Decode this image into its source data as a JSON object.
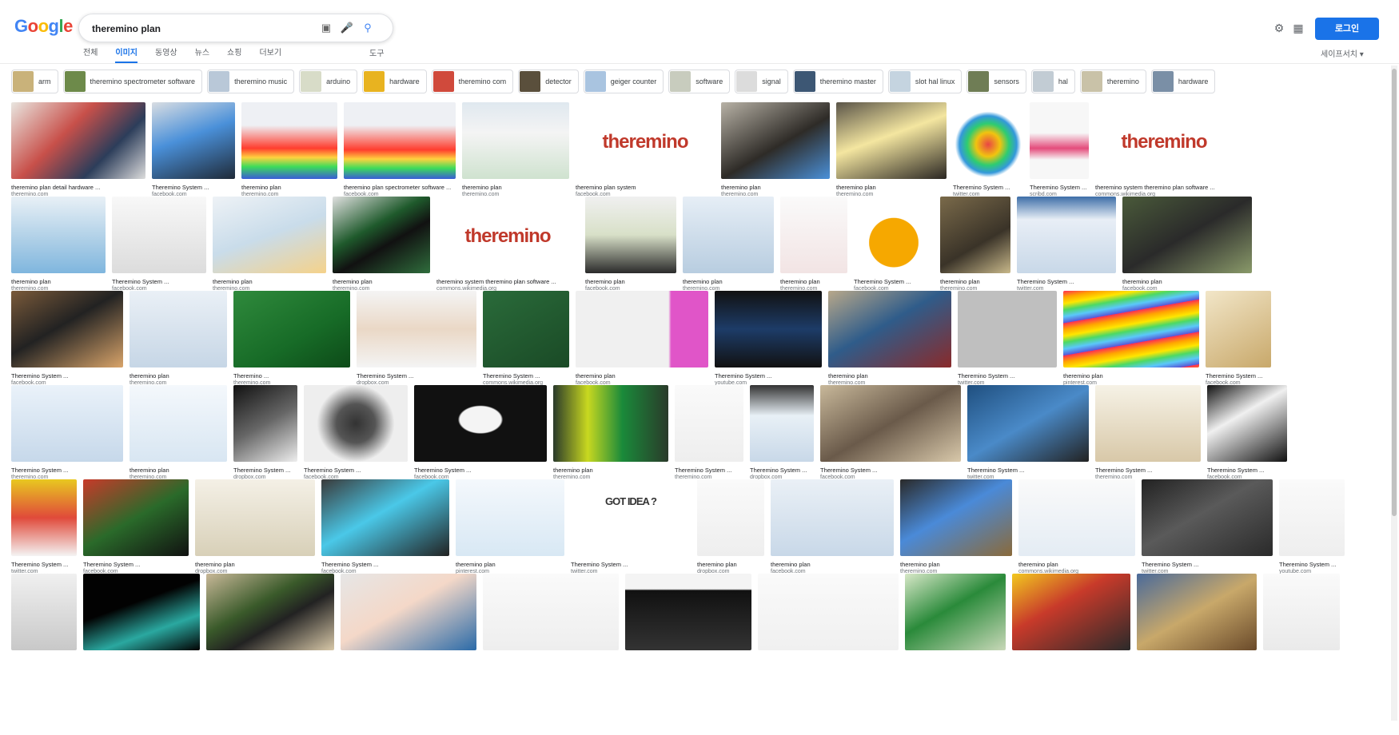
{
  "logo": "Google",
  "search": {
    "query": "theremino plan"
  },
  "header": {
    "sign_in": "로그인"
  },
  "tabs": [
    {
      "label": "전체",
      "active": false
    },
    {
      "label": "이미지",
      "active": true
    },
    {
      "label": "동영상",
      "active": false
    },
    {
      "label": "뉴스",
      "active": false
    },
    {
      "label": "쇼핑",
      "active": false
    },
    {
      "label": "더보기",
      "active": false
    }
  ],
  "tools": "도구",
  "safesearch": "세이프서치 ▾",
  "chips": [
    {
      "label": "arm",
      "color": "#c9b27a"
    },
    {
      "label": "theremino spectrometer software",
      "color": "#6d8a4a"
    },
    {
      "label": "theremino music",
      "color": "#b9c8d8"
    },
    {
      "label": "arduino",
      "color": "#d8dcc8"
    },
    {
      "label": "hardware",
      "color": "#e8b320"
    },
    {
      "label": "theremino com",
      "color": "#d04a3c"
    },
    {
      "label": "detector",
      "color": "#5a4f3c"
    },
    {
      "label": "geiger counter",
      "color": "#a9c4e0"
    },
    {
      "label": "software",
      "color": "#c8ccbe"
    },
    {
      "label": "signal",
      "color": "#dcdcdc"
    },
    {
      "label": "theremino master",
      "color": "#3d5774"
    },
    {
      "label": "slot hal linux",
      "color": "#c5d4e0"
    },
    {
      "label": "sensors",
      "color": "#6f7d55"
    },
    {
      "label": "hal",
      "color": "#c2ccd4"
    },
    {
      "label": "theremino",
      "color": "#c9c2a8"
    },
    {
      "label": "hardware",
      "color": "#7a8fa6"
    }
  ],
  "results": [
    [
      {
        "caption": "theremino plan detail hardware ...",
        "source": "theremino.com",
        "w": 168,
        "bg": "linear-gradient(135deg,#e9e6e0,#c8504a 40%,#2c3d5a 70%,#ddd)"
      },
      {
        "caption": "Theremino System ...",
        "source": "facebook.com",
        "w": 104,
        "bg": "linear-gradient(160deg,#d9dde2,#4a90d9 45%,#1f2a38)"
      },
      {
        "caption": "theremino plan",
        "source": "theremino.com",
        "w": 120,
        "bg": "linear-gradient(180deg,#eef0f4 30%,#ff3d2e 60%,#ffd23f 72%,#3ddc5a 84%,#3a5bd8)"
      },
      {
        "caption": "theremino plan spectrometer software ...",
        "source": "facebook.com",
        "w": 140,
        "bg": "linear-gradient(180deg,#eef0f4 30%,#ff3d2e 62%,#ffd23f 74%,#3ddc5a 86%,#3a5bd8)"
      },
      {
        "caption": "theremino plan",
        "source": "theremino.com",
        "w": 134,
        "bg": "linear-gradient(180deg,#dfe8ef,#f4f4f4 40%,#cfe2cf)"
      },
      {
        "caption": "theremino plan system",
        "source": "facebook.com",
        "w": 174,
        "bg": "#ffffff",
        "brand": "theremino"
      },
      {
        "caption": "theremino plan",
        "source": "theremino.com",
        "w": 136,
        "bg": "linear-gradient(150deg,#b8b2a6,#2e2b27 55%,#4a90d9)"
      },
      {
        "caption": "theremino plan",
        "source": "theremino.com",
        "w": 138,
        "bg": "linear-gradient(160deg,#5a5448,#f4e6a0 45%,#2a2622)"
      },
      {
        "caption": "Theremino System ...",
        "source": "twitter.com",
        "w": 88,
        "bg": "radial-gradient(circle at 50% 55%,#e94545 0,#f1c40f 22%,#2ecc71 38%,#3498db 52%,#fff 60%)"
      },
      {
        "caption": "Theremino System ...",
        "source": "scribd.com",
        "w": 74,
        "bg": "linear-gradient(180deg,#f7f7f7 40%,#e44c7b 60%,#f7f7f7 75%)"
      },
      {
        "caption": "theremino system theremino plan software ...",
        "source": "commons.wikimedia.org",
        "w": 172,
        "bg": "#ffffff",
        "brand": "theremino"
      }
    ],
    [
      {
        "caption": "theremino plan",
        "source": "theremino.com",
        "w": 118,
        "bg": "linear-gradient(180deg,#e8f0f6,#aacde6 60%,#7fb6de)"
      },
      {
        "caption": "Theremino System ...",
        "source": "facebook.com",
        "w": 118,
        "bg": "linear-gradient(180deg,#f8f8f8,#dcdcdc)"
      },
      {
        "caption": "theremino plan",
        "source": "theremino.com",
        "w": 142,
        "bg": "linear-gradient(160deg,#eef2f6,#c9dcea 50%,#f5d28a)"
      },
      {
        "caption": "theremino plan",
        "source": "theremino.com",
        "w": 122,
        "bg": "linear-gradient(150deg,#e0e0e0,#1f5a2c 40%,#111 60%,#2f6d3c)"
      },
      {
        "caption": "theremino system theremino plan software ...",
        "source": "commons.wikimedia.org",
        "w": 178,
        "bg": "#ffffff",
        "brand": "theremino"
      },
      {
        "caption": "theremino plan",
        "source": "facebook.com",
        "w": 114,
        "bg": "linear-gradient(180deg,#f0f0f0,#d8e0c8 50%,#2a2a2a)"
      },
      {
        "caption": "theremino plan",
        "source": "theremino.com",
        "w": 114,
        "bg": "linear-gradient(180deg,#e6eef6,#b8cde0)"
      },
      {
        "caption": "theremino plan",
        "source": "theremino.com",
        "w": 84,
        "bg": "linear-gradient(180deg,#fafafa,#f2e4e4)"
      },
      {
        "caption": "Theremino System ...",
        "source": "facebook.com",
        "w": 100,
        "bg": "radial-gradient(circle at 50% 60%,#f6a800 0,#f6a800 40%,#fff 41%)"
      },
      {
        "caption": "theremino plan",
        "source": "theremino.com",
        "w": 88,
        "bg": "linear-gradient(150deg,#7a6a4a,#3a3328 60%,#c8b88a)"
      },
      {
        "caption": "Theremino System ...",
        "source": "twitter.com",
        "w": 124,
        "bg": "linear-gradient(180deg,#3d6ea8,#e8eef6 30%,#c8d8e8)"
      },
      {
        "caption": "theremino plan",
        "source": "facebook.com",
        "w": 162,
        "bg": "linear-gradient(150deg,#4a5a3a,#2a2a2a 50%,#8a9a6a)"
      }
    ],
    [
      {
        "caption": "Theremino System ...",
        "source": "facebook.com",
        "w": 140,
        "bg": "linear-gradient(150deg,#7a5a3a,#222 45%,#d9a46a)"
      },
      {
        "caption": "theremino plan",
        "source": "theremino.com",
        "w": 122,
        "bg": "linear-gradient(180deg,#eaf0f6,#c6d6e6)"
      },
      {
        "caption": "Theremino ...",
        "source": "theremino.com",
        "w": 146,
        "bg": "linear-gradient(150deg,#2f8a3c,#176b27 60%,#0d4a18)"
      },
      {
        "caption": "Theremino System ...",
        "source": "dropbox.com",
        "w": 150,
        "bg": "linear-gradient(180deg,#f4f4f4,#ead8c6 50%,#f4f4f4)"
      },
      {
        "caption": "Theremino System ...",
        "source": "commons.wikimedia.org",
        "w": 108,
        "bg": "linear-gradient(150deg,#2a6b3a,#1a4a26)"
      },
      {
        "caption": "theremino plan",
        "source": "facebook.com",
        "w": 166,
        "bg": "linear-gradient(90deg,#f0f0f0 70%,#e055c8 72%,#e055c8)"
      },
      {
        "caption": "Theremino System ...",
        "source": "youtube.com",
        "w": 134,
        "bg": "linear-gradient(180deg,#111,#1d3c68 50%,#111)"
      },
      {
        "caption": "theremino plan",
        "source": "theremino.com",
        "w": 154,
        "bg": "linear-gradient(150deg,#b8a88a,#2f5c8a 45%,#8a2a2a)"
      },
      {
        "caption": "Theremino System ...",
        "source": "twitter.com",
        "w": 124,
        "bg": "#bfbfbf"
      },
      {
        "caption": "theremino plan",
        "source": "pinterest.com",
        "w": 170,
        "bg": "repeating-linear-gradient(170deg,#ff2d55 0,#ffa500 8px,#ffe600 16px,#4cd964 24px,#5ac8fa 32px,#5856d6 40px)"
      },
      {
        "caption": "Theremino System ...",
        "source": "facebook.com",
        "w": 82,
        "bg": "linear-gradient(150deg,#f2e6c8,#c8a86a)"
      }
    ],
    [
      {
        "caption": "Theremino System ...",
        "source": "theremino.com",
        "w": 140,
        "bg": "linear-gradient(180deg,#eaf2fa,#c6d8ea)"
      },
      {
        "caption": "theremino plan",
        "source": "theremino.com",
        "w": 122,
        "bg": "linear-gradient(180deg,#f4f8fc,#d8e6f2)"
      },
      {
        "caption": "Theremino System ...",
        "source": "dropbox.com",
        "w": 80,
        "bg": "linear-gradient(150deg,#111,#666 50%,#eee)"
      },
      {
        "caption": "Theremino System ...",
        "source": "facebook.com",
        "w": 130,
        "bg": "radial-gradient(circle,#333 0,#555 30%,#eee 60%)"
      },
      {
        "caption": "Theremino System ...",
        "source": "facebook.com",
        "w": 166,
        "bg": "radial-gradient(ellipse at 50% 45%,#f4f4f4 0,#f4f4f4 22%,#111 24%)"
      },
      {
        "caption": "theremino plan",
        "source": "theremino.com",
        "w": 144,
        "bg": "linear-gradient(90deg,#2a3a2a,#c8d820 30%,#1a8a3a 60%,#2a3a2a)"
      },
      {
        "caption": "Theremino System ...",
        "source": "theremino.com",
        "w": 86,
        "bg": "linear-gradient(180deg,#fafafa,#eeeeee)"
      },
      {
        "caption": "Theremino System ...",
        "source": "dropbox.com",
        "w": 80,
        "bg": "linear-gradient(180deg,#333,#e8f0f6 40%,#c8d8e8)"
      },
      {
        "caption": "Theremino System ...",
        "source": "facebook.com",
        "w": 176,
        "bg": "linear-gradient(150deg,#c8b89a,#6a5a4a 50%,#d8c8aa)"
      },
      {
        "caption": "Theremino System ...",
        "source": "twitter.com",
        "w": 152,
        "bg": "linear-gradient(150deg,#1f4f7f,#4a8ac8 50%,#222)"
      },
      {
        "caption": "Theremino System ...",
        "source": "theremino.com",
        "w": 132,
        "bg": "linear-gradient(180deg,#f6f2e6,#d8c8a8)"
      },
      {
        "caption": "Theremino System ...",
        "source": "facebook.com",
        "w": 100,
        "bg": "linear-gradient(150deg,#111,#f0f0f0 40%,#111)"
      }
    ],
    [
      {
        "caption": "Theremino System ...",
        "source": "twitter.com",
        "w": 82,
        "bg": "linear-gradient(180deg,#e8c820,#e04a3a 50%,#f4f4f4)"
      },
      {
        "caption": "Theremino System ...",
        "source": "facebook.com",
        "w": 132,
        "bg": "linear-gradient(150deg,#c83a2a,#2a6a2a 50%,#111)"
      },
      {
        "caption": "theremino plan",
        "source": "dropbox.com",
        "w": 150,
        "bg": "linear-gradient(180deg,#f4f0e6,#d8d0b8)"
      },
      {
        "caption": "Theremino System ...",
        "source": "facebook.com",
        "w": 160,
        "bg": "linear-gradient(150deg,#3a3a3a,#4ac8e8 45%,#222)"
      },
      {
        "caption": "theremino plan",
        "source": "pinterest.com",
        "w": 136,
        "bg": "linear-gradient(180deg,#f4f8fc,#d8e8f4)"
      },
      {
        "caption": "Theremino System ...",
        "source": "twitter.com",
        "w": 150,
        "bg": "#ffffff",
        "brand": "GOT IDEA ?"
      },
      {
        "caption": "theremino plan",
        "source": "dropbox.com",
        "w": 84,
        "bg": "linear-gradient(180deg,#fafafa,#eeeeee)"
      },
      {
        "caption": "theremino plan",
        "source": "facebook.com",
        "w": 154,
        "bg": "linear-gradient(180deg,#eaf0f6,#c8d8e8)"
      },
      {
        "caption": "theremino plan",
        "source": "theremino.com",
        "w": 140,
        "bg": "linear-gradient(150deg,#2a2a2a,#4a8ad8 45%,#8a6a3a)"
      },
      {
        "caption": "theremino plan",
        "source": "commons.wikimedia.org",
        "w": 146,
        "bg": "linear-gradient(180deg,#fafafa,#e4ecf4)"
      },
      {
        "caption": "Theremino System ...",
        "source": "twitter.com",
        "w": 164,
        "bg": "linear-gradient(150deg,#222,#5a5a5a 45%,#2a2a2a)"
      },
      {
        "caption": "Theremino System ...",
        "source": "youtube.com",
        "w": 82,
        "bg": "linear-gradient(180deg,#fafafa,#eeeeee)"
      }
    ],
    [
      {
        "caption": "",
        "source": "",
        "w": 82,
        "bg": "linear-gradient(180deg,#f0f0f0,#c8c8c8)"
      },
      {
        "caption": "",
        "source": "",
        "w": 146,
        "bg": "linear-gradient(160deg,#020202 40%,#2aa8a0 70%,#020202)"
      },
      {
        "caption": "",
        "source": "",
        "w": 160,
        "bg": "linear-gradient(150deg,#c8b898,#3a5a2a 40%,#222 60%,#d8c8a8)"
      },
      {
        "caption": "",
        "source": "",
        "w": 170,
        "bg": "linear-gradient(150deg,#e6e6e6,#f4d8c8 45%,#2a6aa8)"
      },
      {
        "caption": "",
        "source": "",
        "w": 170,
        "bg": "linear-gradient(180deg,#fafafa,#eeeeee)"
      },
      {
        "caption": "",
        "source": "",
        "w": 158,
        "bg": "linear-gradient(180deg,#f4f4f4 20%,#111 22%,#333)"
      },
      {
        "caption": "",
        "source": "",
        "w": 176,
        "bg": "linear-gradient(180deg,#fafafa,#f0f0f0)"
      },
      {
        "caption": "",
        "source": "",
        "w": 126,
        "bg": "linear-gradient(150deg,#d8e8c8,#2a8a3a 45%,#c8d8b8)"
      },
      {
        "caption": "",
        "source": "",
        "w": 148,
        "bg": "linear-gradient(150deg,#f2c820,#c83a2a 40%,#2a2a2a)"
      },
      {
        "caption": "",
        "source": "",
        "w": 150,
        "bg": "linear-gradient(150deg,#4a6a9a,#c8a86a 50%,#6a4a2a)"
      },
      {
        "caption": "",
        "source": "",
        "w": 96,
        "bg": "linear-gradient(180deg,#fafafa,#eaeaea)"
      }
    ]
  ]
}
